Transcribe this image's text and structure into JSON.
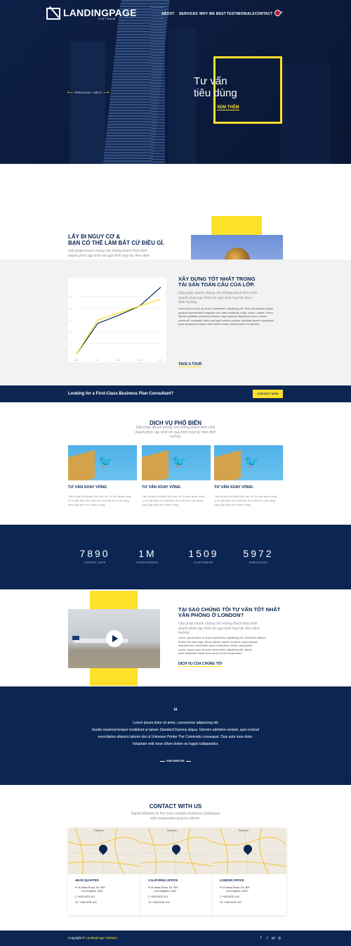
{
  "header": {
    "logo_text": "LANDINGPAGE",
    "logo_sub": "VIETNAM",
    "nav": [
      "ABOUT",
      "SERVICES",
      "WHY WE BEST",
      "TESTIMONIALS",
      "CONTACT"
    ],
    "lang_caret": "▾"
  },
  "hero": {
    "title_line1": "Tư vấn",
    "title_line2": "tiêu dùng",
    "link": "XEM THÊM",
    "prev": "PREVIOUS",
    "sep": "/",
    "next": "NEXT"
  },
  "risk": {
    "title_line1": "LẤY ĐI NGUY CƠ &",
    "title_line2": "BẠN CÓ THỂ LÀM BẤT CỨ ĐIỀU GÌ.",
    "desc_line1": "Giải pháp nhanh chóng cho những thách thức kinh",
    "desc_line2": "doanh phức tạp nhất với quá trình hợp tác theo định"
  },
  "build": {
    "title_line1": "XÂY DỰNG TỐT NHẤT TRONG",
    "title_line2": "TÀI SẢN TOÀN CẦU CỦA LỚP.",
    "intro_line1": "Giải pháp nhanh chóng cho những thách thức kinh",
    "intro_line2": "doanh phức tạp nhất với quá trình hợp tác theo",
    "intro_line3": "định hướng.",
    "body_line1": "Lorem ipsum dolor sit amet, consectetur adipisicing elit. Vero sed quidem iusque.",
    "body_line2": "quaerat reprehenderit magnam cum alias recidendo nobis. Nemo, autem. Libero",
    "body_line3": "officiis cupiditate possimus aliquam, fuga quaerat! Asperiores rerum, labore",
    "body_line4": "commodi, numquam ullam quo fugit maxime pariatur voluptate facere voluptatum",
    "body_line5": "quas voluptatem eaque nihil maxime nobis soluta evenie a molestiae.",
    "link": "TAKE A TOUR"
  },
  "chart_data": {
    "type": "line",
    "categories": [
      "2021",
      "2022",
      "2023",
      "2024",
      "2025"
    ],
    "series": [
      {
        "values": [
          1,
          27,
          34,
          42,
          58
        ],
        "color": "#0c2653"
      },
      {
        "values": [
          1,
          30,
          36,
          42,
          48
        ],
        "color": "#fde02a"
      }
    ],
    "ylim": [
      0,
      60
    ],
    "yticks": [
      "50",
      "40",
      "30",
      "20",
      "10"
    ],
    "grid": true
  },
  "cta": {
    "text": "Looking for a First-Class Business Plan Consultant?",
    "button": "CONTACT NOW"
  },
  "services": {
    "title": "DỊCH VỤ PHỔ BIẾN",
    "sub_line1": "Giải pháp nhanh chóng cho những thách thức kinh",
    "sub_line2": "doanh phức tạp nhất với quá trình hợp tác theo định",
    "sub_line3": "hướng.",
    "items": [
      {
        "title": "TƯ VẤN XOAY VÒNG",
        "d1": "Các công ty không thích cụm từ 'tư vấn quay vòng'",
        "d2": "vì nó đại diện cho thất bại. Sự thật là tư vấn quay",
        "d3": "vòng đại diện cho thành công."
      },
      {
        "title": "TƯ VẤN XOAY VÒNG",
        "d1": "Các công ty không thích cụm từ 'tư vấn quay vòng'",
        "d2": "vì nó đại diện cho thất bại. Sự thật là tư vấn quay",
        "d3": "vòng đại diện cho thành công."
      },
      {
        "title": "TƯ VẤN XOAY VÒNG",
        "d1": "Các công ty không thích cụm từ 'tư vấn quay vòng'",
        "d2": "vì nó đại diện cho thất bại. Sự thật là tư vấn quay",
        "d3": "vòng đại diện cho thành công."
      }
    ]
  },
  "stats": [
    {
      "num": "7890",
      "label": "COFFEE CUPS"
    },
    {
      "num": "1M",
      "label": "SUBSCRIBERS"
    },
    {
      "num": "1509",
      "label": "CUSTOMERS"
    },
    {
      "num": "5972",
      "label": "PURCHASES"
    }
  ],
  "why": {
    "title_line1": "TẠI SAO CHÚNG TÔI TƯ VẤN TỐT NHẤT",
    "title_line2": "VĂN PHÒNG Ở LONDON?",
    "intro_line1": "Giải pháp nhanh chóng cho những thách thức kinh",
    "intro_line2": "doanh phức tạp nhất với quá trình hợp tác theo định",
    "intro_line3": "hướng.",
    "body_line1": "Lorem, ipsum dolor sit amet consectetur adipisicing elit. Architecto adipisci",
    "body_line2": "et alice illo iusto fuga, labore pariatur quasi inventore culpa aliquam",
    "body_line3": "nesciunt enim aspernatur quos consectetur dolore, quibusdam.",
    "body_line4": "Lorem, ipsum dolor sit amet consectetur adipisicing elit, labore,",
    "body_line5": "quos voluptates eaque ipsa earum sit ea recusandae!",
    "link": "DỊCH VỤ CỦA CHÚNG TÔI"
  },
  "testimonial": {
    "quote_mark": "“",
    "line1": "Lorem ipsum dolor sit amet, consectetur adipisicing elit",
    "line2": "Seddo eiusmod tempor incididunt ut labore Standard Dummy aliqua. Uternim adminim veniam, quis nostrud",
    "line3": "exercitation ullamco laboris nisi ut Unknown Printer The Commodo consequat. Duis aute irure dolor.",
    "line4": "Voluptate velit esse cillum dolore eu fugiat nullapariatur.",
    "author": "SAM ISBISTER"
  },
  "contact": {
    "title": "CONTACT WITH US",
    "sub_line1": "Rapid solutions to the most complex business challenges",
    "sub_line2": "with cooperative process-driven.",
    "offices": [
      {
        "name": "HEAD QUARTER",
        "addr1": "14 Maxs Road, N1 4EE",
        "addr2": "Los Angeles, USA",
        "phone1": "+445 6231 411",
        "phone2": "+445 6231 411",
        "city": "Paterson"
      },
      {
        "name": "CALIFORNIA OFFICE",
        "addr1": "14 Maxs Road, N1 4EE",
        "addr2": "Los Angeles, USA",
        "phone1": "+445 6231 411",
        "phone2": "+445 6231 411",
        "city": "Paterson"
      },
      {
        "name": "LONDON OFFICE",
        "addr1": "14 Maxs Road, N1 4EE",
        "addr2": "Los Angeles, USA",
        "phone1": "+445 6231 411",
        "phone2": "+445 6231 411",
        "city": "Paterson"
      }
    ]
  },
  "footer": {
    "copyright": "Copyright © ",
    "brand": "LandingPage VietNam",
    "social": [
      "f",
      "t",
      "g+",
      "◎"
    ]
  }
}
